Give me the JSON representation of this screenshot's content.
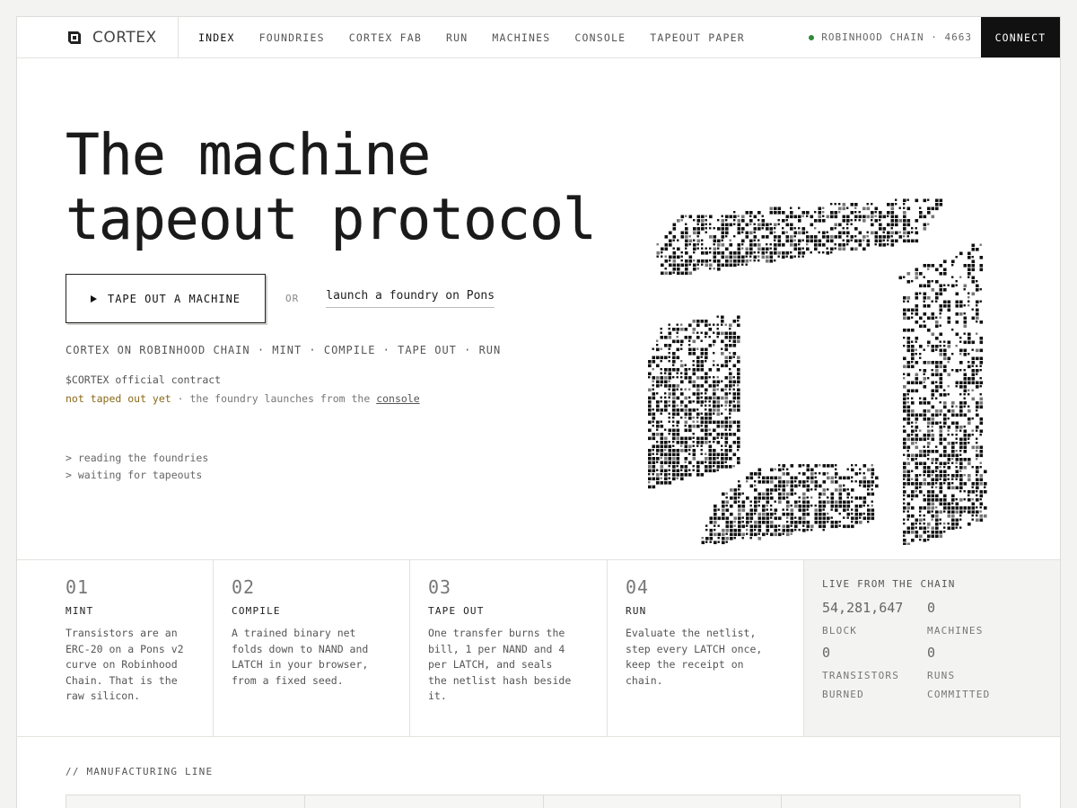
{
  "nav": {
    "brand": "CORTEX",
    "links": [
      "INDEX",
      "FOUNDRIES",
      "CORTEX FAB",
      "RUN",
      "MACHINES",
      "CONSOLE",
      "TAPEOUT PAPER"
    ],
    "chain_status": "ROBINHOOD CHAIN · 4663",
    "connect_label": "CONNECT"
  },
  "hero": {
    "title": "The machine\ntapeout protocol",
    "cta_label": "TAPE OUT A MACHINE",
    "or_label": "OR",
    "alt_link": "launch a foundry on Pons",
    "tagline": "CORTEX ON ROBINHOOD CHAIN · MINT · COMPILE · TAPE OUT · RUN",
    "contract_label": "$CORTEX official contract",
    "status_warn": "not taped out yet",
    "status_mid": " · the foundry launches from the ",
    "status_link": "console",
    "log": [
      "> reading the foundries",
      "> waiting for tapeouts"
    ]
  },
  "steps": [
    {
      "num": "01",
      "title": "MINT",
      "desc": "Transistors are an ERC-20 on a Pons v2 curve on Robinhood Chain. That is the raw silicon."
    },
    {
      "num": "02",
      "title": "COMPILE",
      "desc": "A trained binary net folds down to NAND and LATCH in your browser, from a fixed seed."
    },
    {
      "num": "03",
      "title": "TAPE OUT",
      "desc": "One transfer burns the bill, 1 per NAND and 4 per LATCH, and seals the netlist hash beside it."
    },
    {
      "num": "04",
      "title": "RUN",
      "desc": "Evaluate the netlist, step every LATCH once, keep the receipt on chain."
    }
  ],
  "live": {
    "title": "LIVE FROM THE CHAIN",
    "stats": [
      {
        "value": "54,281,647",
        "label": "BLOCK"
      },
      {
        "value": "0",
        "label": "MACHINES"
      },
      {
        "value": "0",
        "label": "TRANSISTORS BURNED"
      },
      {
        "value": "0",
        "label": "RUNS COMMITTED"
      }
    ]
  },
  "manufacturing": {
    "title": "// MANUFACTURING LINE"
  },
  "colors": {
    "accent": "#111111",
    "status_ok": "#2f8a3c",
    "status_warn": "#8a6a1a"
  }
}
